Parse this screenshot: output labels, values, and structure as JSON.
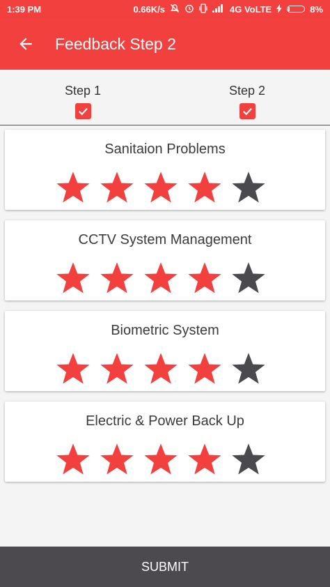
{
  "status_bar": {
    "time": "1:39 PM",
    "net_speed": "0.66K/s",
    "network": "4G VoLTE",
    "battery_percent": "8%",
    "battery_level": 0.08,
    "icons": [
      "mute-icon",
      "alarm-icon",
      "vibrate-icon",
      "signal-icon",
      "charging-icon",
      "battery-icon"
    ]
  },
  "app_bar": {
    "title": "Feedback Step 2",
    "back_icon": "arrow-left-icon"
  },
  "steps": [
    {
      "label": "Step 1",
      "checked": true
    },
    {
      "label": "Step 2",
      "checked": true
    }
  ],
  "ratings": [
    {
      "title": "Sanitaion Problems",
      "rating": 4,
      "max": 5
    },
    {
      "title": "CCTV System Management",
      "rating": 4,
      "max": 5
    },
    {
      "title": "Biometric System",
      "rating": 4,
      "max": 5
    },
    {
      "title": "Electric & Power Back Up",
      "rating": 4,
      "max": 5
    }
  ],
  "colors": {
    "primary": "#f1403d",
    "star_active": "#f1403d",
    "star_inactive": "#4a4a4e",
    "submit_bg": "#4c4a4e"
  },
  "submit_label": "SUBMIT"
}
